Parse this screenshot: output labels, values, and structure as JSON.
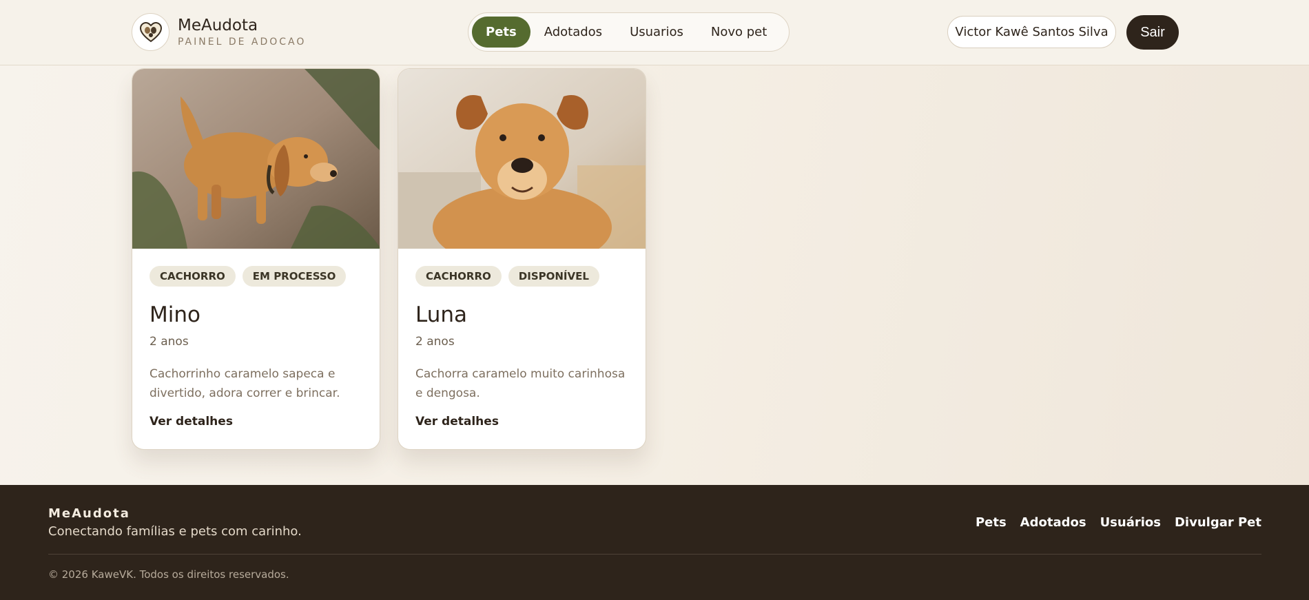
{
  "header": {
    "brand_name": "MeAudota",
    "brand_subtitle": "PAINEL DE ADOCAO",
    "logo_icon": "paw-heart-icon",
    "nav": [
      {
        "label": "Pets",
        "active": true
      },
      {
        "label": "Adotados",
        "active": false
      },
      {
        "label": "Usuarios",
        "active": false
      },
      {
        "label": "Novo pet",
        "active": false
      }
    ],
    "user_name": "Victor Kawê Santos Silva",
    "logout_label": "Sair"
  },
  "pets": [
    {
      "tags": [
        "CACHORRO",
        "EM PROCESSO"
      ],
      "name": "Mino",
      "age": "2 anos",
      "description": "Cachorrinho caramelo sapeca e divertido, adora correr e brincar.",
      "link": "Ver detalhes"
    },
    {
      "tags": [
        "CACHORRO",
        "DISPONÍVEL"
      ],
      "name": "Luna",
      "age": "2 anos",
      "description": "Cachorra caramelo muito carinhosa e dengosa.",
      "link": "Ver detalhes"
    }
  ],
  "footer": {
    "brand": "MeAudota",
    "tagline": "Conectando famílias e pets com carinho.",
    "links": [
      "Pets",
      "Adotados",
      "Usuários",
      "Divulgar Pet"
    ],
    "copyright": "© 2026 KaweVK. Todos os direitos reservados."
  },
  "colors": {
    "accent": "#556b2f",
    "dark": "#2e241b",
    "background": "#f6f2ea",
    "tag_bg": "#ede9dc"
  }
}
